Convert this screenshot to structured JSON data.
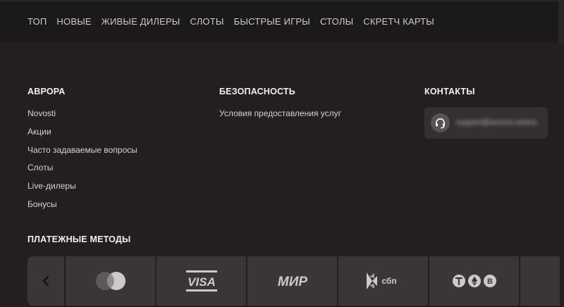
{
  "nav": {
    "items": [
      "ТОП",
      "НОВЫЕ",
      "ЖИВЫЕ ДИЛЕРЫ",
      "СЛОТЫ",
      "БЫСТРЫЕ ИГРЫ",
      "СТОЛЫ",
      "СКРЕТЧ КАРТЫ"
    ]
  },
  "footer": {
    "aurora": {
      "title": "АВРОРА",
      "links": [
        "Novosti",
        "Акции",
        "Часто задаваемые вопросы",
        "Слоты",
        "Live-дилеры",
        "Бонусы"
      ]
    },
    "security": {
      "title": "БЕЗОПАСНОСТЬ",
      "links": [
        "Условия предоставления услуг"
      ]
    },
    "contacts": {
      "title": "КОНТАКТЫ",
      "email": "support@aurora.casino",
      "icon": "headset-icon"
    }
  },
  "payments": {
    "title": "ПЛАТЕЖНЫЕ МЕТОДЫ",
    "prev_icon": "chevron-left-icon",
    "methods": [
      {
        "name": "mastercard",
        "icon": "mastercard-icon"
      },
      {
        "name": "visa",
        "label": "VISA",
        "icon": "visa-icon"
      },
      {
        "name": "mir",
        "label": "МИР",
        "icon": "mir-icon"
      },
      {
        "name": "sbp",
        "label": "сбп",
        "icon": "sbp-icon"
      },
      {
        "name": "crypto",
        "icon": "crypto-icon"
      }
    ]
  }
}
